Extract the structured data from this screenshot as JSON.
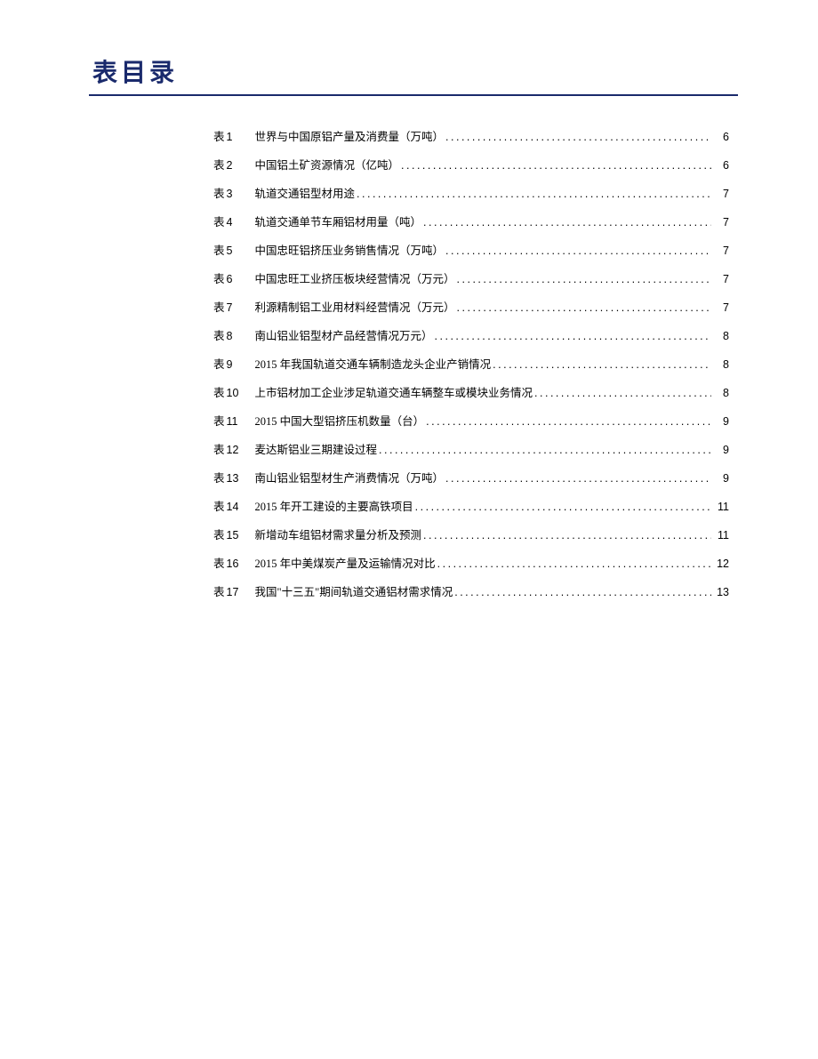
{
  "heading": "表目录",
  "entry_prefix": "表",
  "entries": [
    {
      "num": "1",
      "title": "世界与中国原铝产量及消费量（万吨）",
      "page": "6"
    },
    {
      "num": "2",
      "title": "中国铝土矿资源情况（亿吨）",
      "page": "6"
    },
    {
      "num": "3",
      "title": "轨道交通铝型材用途",
      "page": "7"
    },
    {
      "num": "4",
      "title": "轨道交通单节车厢铝材用量（吨）",
      "page": "7"
    },
    {
      "num": "5",
      "title": "中国忠旺铝挤压业务销售情况（万吨）",
      "page": "7"
    },
    {
      "num": "6",
      "title": "中国忠旺工业挤压板块经营情况（万元）",
      "page": "7"
    },
    {
      "num": "7",
      "title": "利源精制铝工业用材料经营情况（万元）",
      "page": "7"
    },
    {
      "num": "8",
      "title": "南山铝业铝型材产品经营情况万元）",
      "page": "8"
    },
    {
      "num": "9",
      "title": "2015 年我国轨道交通车辆制造龙头企业产销情况",
      "page": "8"
    },
    {
      "num": "10",
      "title": "上市铝材加工企业涉足轨道交通车辆整车或模块业务情况",
      "page": "8"
    },
    {
      "num": "11",
      "title": "2015 中国大型铝挤压机数量（台）",
      "page": "9"
    },
    {
      "num": "12",
      "title": "麦达斯铝业三期建设过程",
      "page": "9"
    },
    {
      "num": "13",
      "title": "南山铝业铝型材生产消费情况（万吨）",
      "page": "9"
    },
    {
      "num": "14",
      "title": "2015 年开工建设的主要高铁项目",
      "page": "11"
    },
    {
      "num": "15",
      "title": "新增动车组铝材需求量分析及预测",
      "page": "11"
    },
    {
      "num": "16",
      "title": "2015 年中美煤炭产量及运输情况对比",
      "page": "12"
    },
    {
      "num": "17",
      "title": "我国\"十三五\"期间轨道交通铝材需求情况",
      "page": "13"
    }
  ]
}
